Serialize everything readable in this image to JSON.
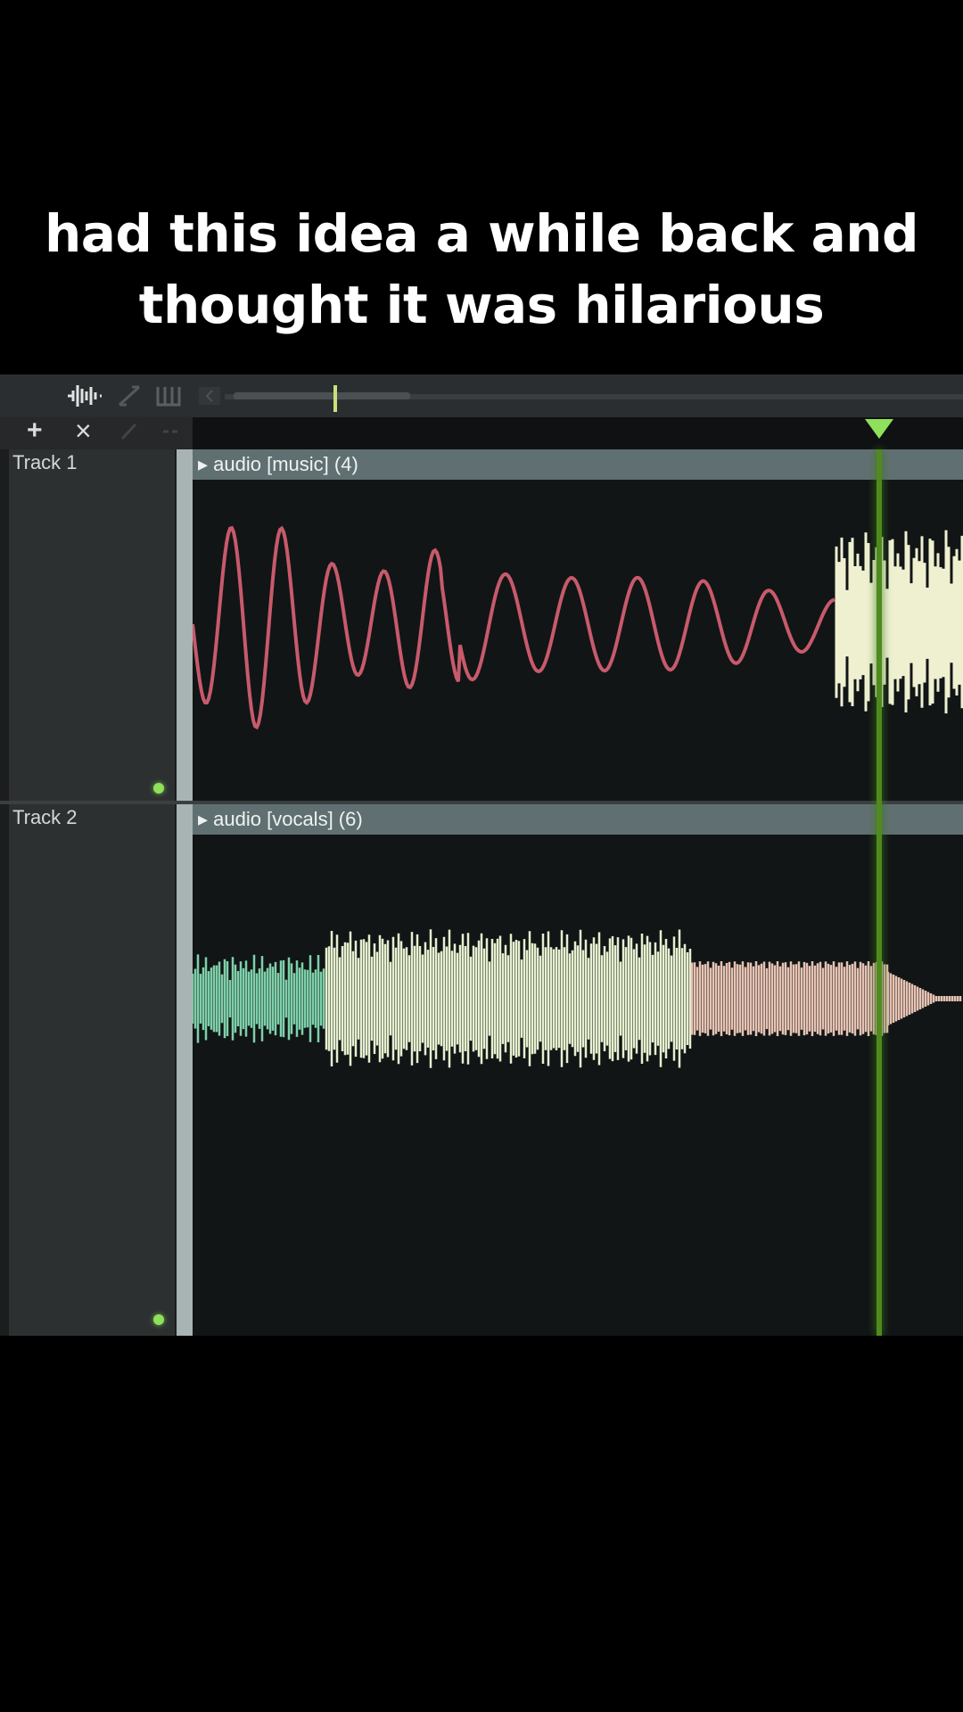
{
  "caption": "had this idea a while back and\nthought it was hilarious",
  "toolbar": {
    "icons": [
      "waveform-icon",
      "stretch-icon",
      "grid-icon",
      "prev-icon",
      "add-icon",
      "close-icon",
      "pencil-icon",
      "link-icon"
    ],
    "add_glyph": "+",
    "close_glyph": "×"
  },
  "tracks": [
    {
      "label": "Track 1",
      "clip_title": "▸ audio [music] (4)",
      "wave_color": "#c75a6b",
      "wave_highlight_color": "#eef0d0"
    },
    {
      "label": "Track 2",
      "clip_title": "▸ audio [vocals] (6)",
      "wave_colors": [
        "#7fd0aa",
        "#e6f0cf",
        "#e7c3b3"
      ]
    }
  ],
  "colors": {
    "accent": "#8fe05a",
    "clip_header": "#607072",
    "lane_bg": "#111516"
  }
}
